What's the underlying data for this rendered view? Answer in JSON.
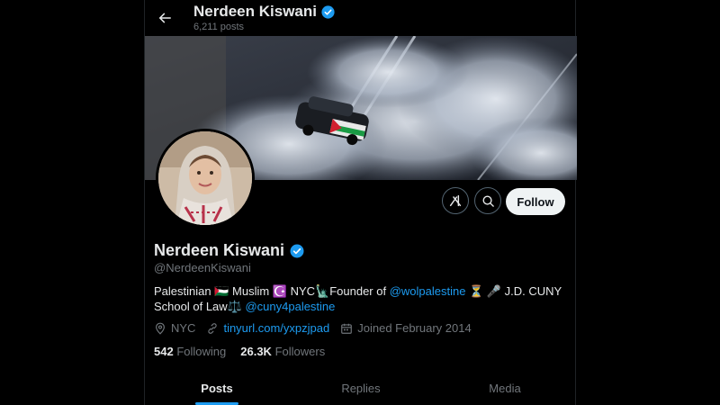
{
  "header": {
    "back_icon": "arrow-left-icon",
    "name": "Nerdeen Kiswani",
    "post_count": "6,211 posts"
  },
  "profile": {
    "display_name": "Nerdeen Kiswani",
    "handle": "@NerdeenKiswani",
    "verified_icon": "verified-badge-icon",
    "bio": {
      "part1": "Palestinian 🇵🇸 Muslim ☪️ NYC🗽Founder of ",
      "link1": "@wolpalestine",
      "part2": " ⏳ 🎤 J.D. CUNY School of Law⚖️ ",
      "link2": "@cuny4palestine"
    },
    "location": "NYC",
    "website": "tinyurl.com/yxpzjpad",
    "joined": "Joined February 2014",
    "following_count": "542",
    "following_label": "Following",
    "followers_count": "26.3K",
    "followers_label": "Followers"
  },
  "actions": {
    "grok_icon": "grok-icon",
    "search_icon": "search-icon",
    "follow_label": "Follow"
  },
  "tabs": [
    {
      "label": "Posts",
      "active": true
    },
    {
      "label": "Replies",
      "active": false
    },
    {
      "label": "Media",
      "active": false
    }
  ],
  "colors": {
    "accent": "#1d9bf0",
    "background": "#000000",
    "secondary_text": "#71767b"
  }
}
